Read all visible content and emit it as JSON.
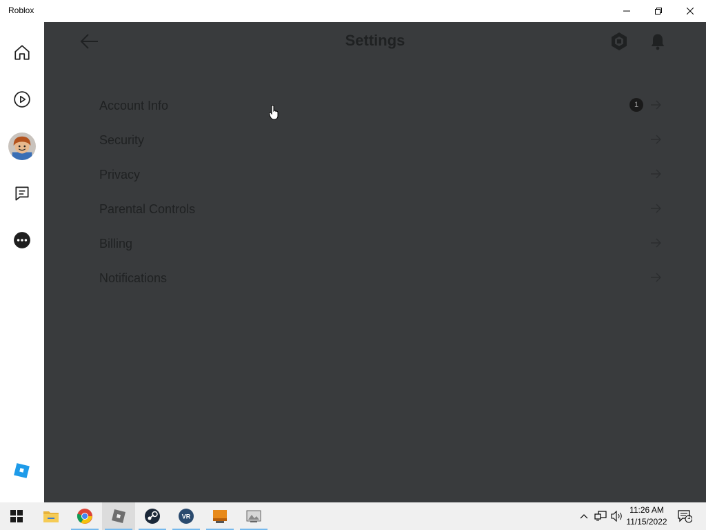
{
  "window": {
    "title": "Roblox",
    "minimize_icon": "minimize-icon",
    "restore_icon": "restore-icon",
    "close_icon": "close-icon"
  },
  "sidebar": {
    "items": [
      {
        "name": "home",
        "icon": "home-icon"
      },
      {
        "name": "discover",
        "icon": "play-circle-icon"
      },
      {
        "name": "avatar",
        "icon": "avatar-image"
      },
      {
        "name": "chat",
        "icon": "chat-icon"
      },
      {
        "name": "more",
        "icon": "more-icon"
      }
    ],
    "logo_icon": "roblox-logo-icon"
  },
  "header": {
    "title": "Settings",
    "back_icon": "back-arrow-icon",
    "robux_icon": "robux-icon",
    "bell_icon": "bell-icon"
  },
  "settings": {
    "items": [
      {
        "label": "Account Info",
        "badge": "1"
      },
      {
        "label": "Security"
      },
      {
        "label": "Privacy"
      },
      {
        "label": "Parental Controls"
      },
      {
        "label": "Billing"
      },
      {
        "label": "Notifications"
      }
    ]
  },
  "taskbar": {
    "apps": [
      "start",
      "file-explorer",
      "chrome",
      "roblox",
      "steam",
      "vr",
      "folder",
      "app"
    ],
    "time": "11:26 AM",
    "date": "11/15/2022",
    "notification_count": "1"
  },
  "colors": {
    "overlay": "#393b3d",
    "text_dim": "#1f2122",
    "white": "#ffffff",
    "taskbar": "#f0f0f0",
    "active_underline": "#76b9ed"
  }
}
